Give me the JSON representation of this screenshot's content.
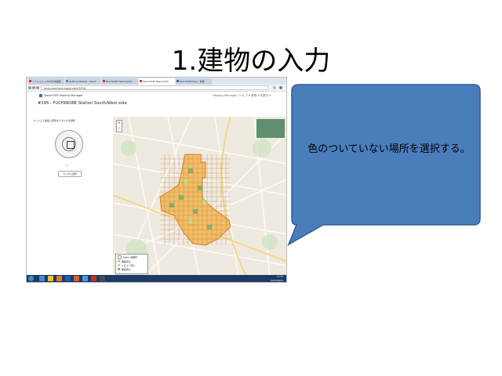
{
  "slide": {
    "title": "1.建物の入力",
    "callout": "色のついていない場所を選択する。"
  },
  "browser": {
    "tabs": [
      "ソーシャル | OSM日本語版",
      "Getting Started - Teach",
      "TeachOSM Tasking Ma...",
      "TeachOSM Tasking Ma",
      "TeachOSM Map - 投票"
    ],
    "url": "tasks.teachosm.org/project/195#"
  },
  "app": {
    "brand": "TeachOSM Tasking Manager",
    "menu": "Tasking Manager / ヘルプ  ▾    新規  ▾   未提示 ▾",
    "project_title": "#195 - FUCHINOBE Station South/West side",
    "tabs": [
      "インストラクション",
      "寄与",
      "活動状況",
      "統計"
    ],
    "panel_prompt": "マップ上で編集に使用するタスクを選択",
    "or_label": "or",
    "random_button": "ランダム選択"
  },
  "legend": {
    "items": [
      "Tasks: 使用中",
      "編集済み",
      "レビュー待ち",
      "確認済み"
    ],
    "colors": [
      "#ffffff",
      "#f7b84c",
      "#c7e08a",
      "#6fb56e"
    ]
  },
  "taskbar": {
    "clock_time": "17:55",
    "clock_date": "2015/06/29",
    "app_colors": [
      "#3d8bd6",
      "#f2c230",
      "#e8762b",
      "#1b5fae",
      "#e05a2b",
      "#38a3d8",
      "#c9302c",
      "#4a4a4a"
    ]
  },
  "icons": [
    "home-icon",
    "zoom-in-icon",
    "zoom-out-icon",
    "start-icon",
    "back-icon",
    "forward-icon",
    "refresh-icon",
    "star-icon",
    "settings-icon"
  ]
}
